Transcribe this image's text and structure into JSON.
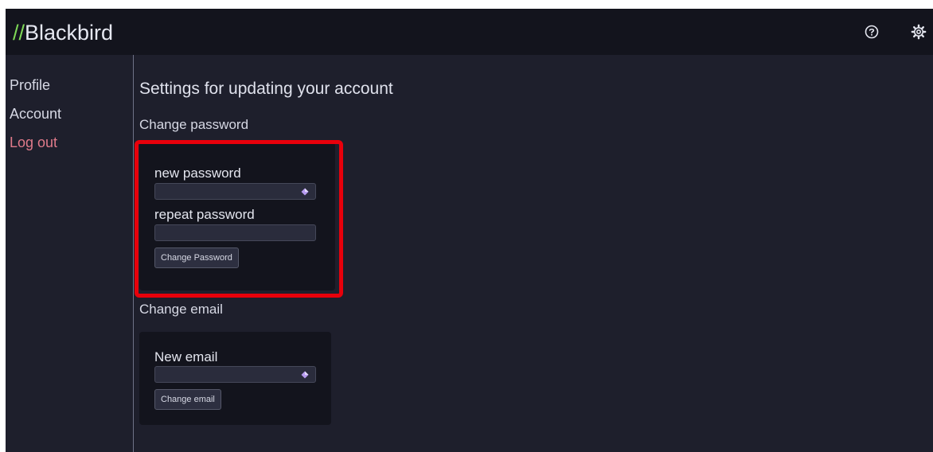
{
  "header": {
    "brand_prefix": "//",
    "brand_name": "Blackbird",
    "help_icon": "help-circle-icon",
    "settings_icon": "gear-icon"
  },
  "sidebar": {
    "items": [
      {
        "label": "Profile"
      },
      {
        "label": "Account"
      },
      {
        "label": "Log out"
      }
    ]
  },
  "main": {
    "title": "Settings for updating your account",
    "change_password": {
      "heading": "Change password",
      "new_password_label": "new password",
      "new_password_value": "",
      "repeat_password_label": "repeat password",
      "repeat_password_value": "",
      "button_label": "Change Password"
    },
    "change_email": {
      "heading": "Change email",
      "new_email_label": "New email",
      "new_email_value": "",
      "button_label": "Change email"
    }
  },
  "colors": {
    "background": "#1e1f2c",
    "header_background": "#13141d",
    "card_background": "#13141d",
    "brand_accent": "#7ed957",
    "logout_color": "#e07a8a",
    "highlight_border": "#e8000b"
  }
}
